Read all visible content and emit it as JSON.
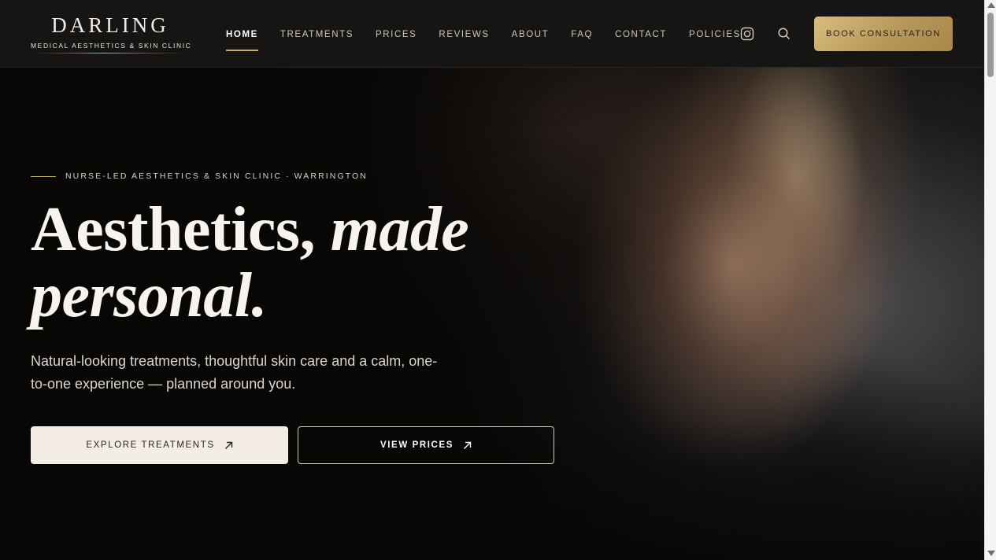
{
  "brand": {
    "name": "DARLING",
    "tagline": "MEDICAL AESTHETICS & SKIN CLINIC"
  },
  "nav": {
    "items": [
      {
        "label": "HOME",
        "active": true
      },
      {
        "label": "TREATMENTS"
      },
      {
        "label": "PRICES"
      },
      {
        "label": "REVIEWS"
      },
      {
        "label": "ABOUT"
      },
      {
        "label": "FAQ"
      },
      {
        "label": "CONTACT"
      },
      {
        "label": "POLICIES"
      }
    ],
    "icons": [
      "instagram-icon",
      "search-icon"
    ],
    "cta_label": "BOOK CONSULTATION"
  },
  "hero": {
    "eyebrow": "NURSE-LED AESTHETICS & SKIN CLINIC · WARRINGTON",
    "headline_part1": "Aesthetics,",
    "headline_italic1": "made",
    "headline_italic2": "personal.",
    "lead": "Natural-looking treatments, thoughtful skin care and a calm, one-to-one experience — planned around you.",
    "primary_button": "EXPLORE TREATMENTS",
    "secondary_button": "VIEW PRICES"
  },
  "colors": {
    "accent_gold": "#c9a86a",
    "header_bg": "#161514",
    "hero_bg": "#0b0a09",
    "button_light": "#f3ede6"
  }
}
